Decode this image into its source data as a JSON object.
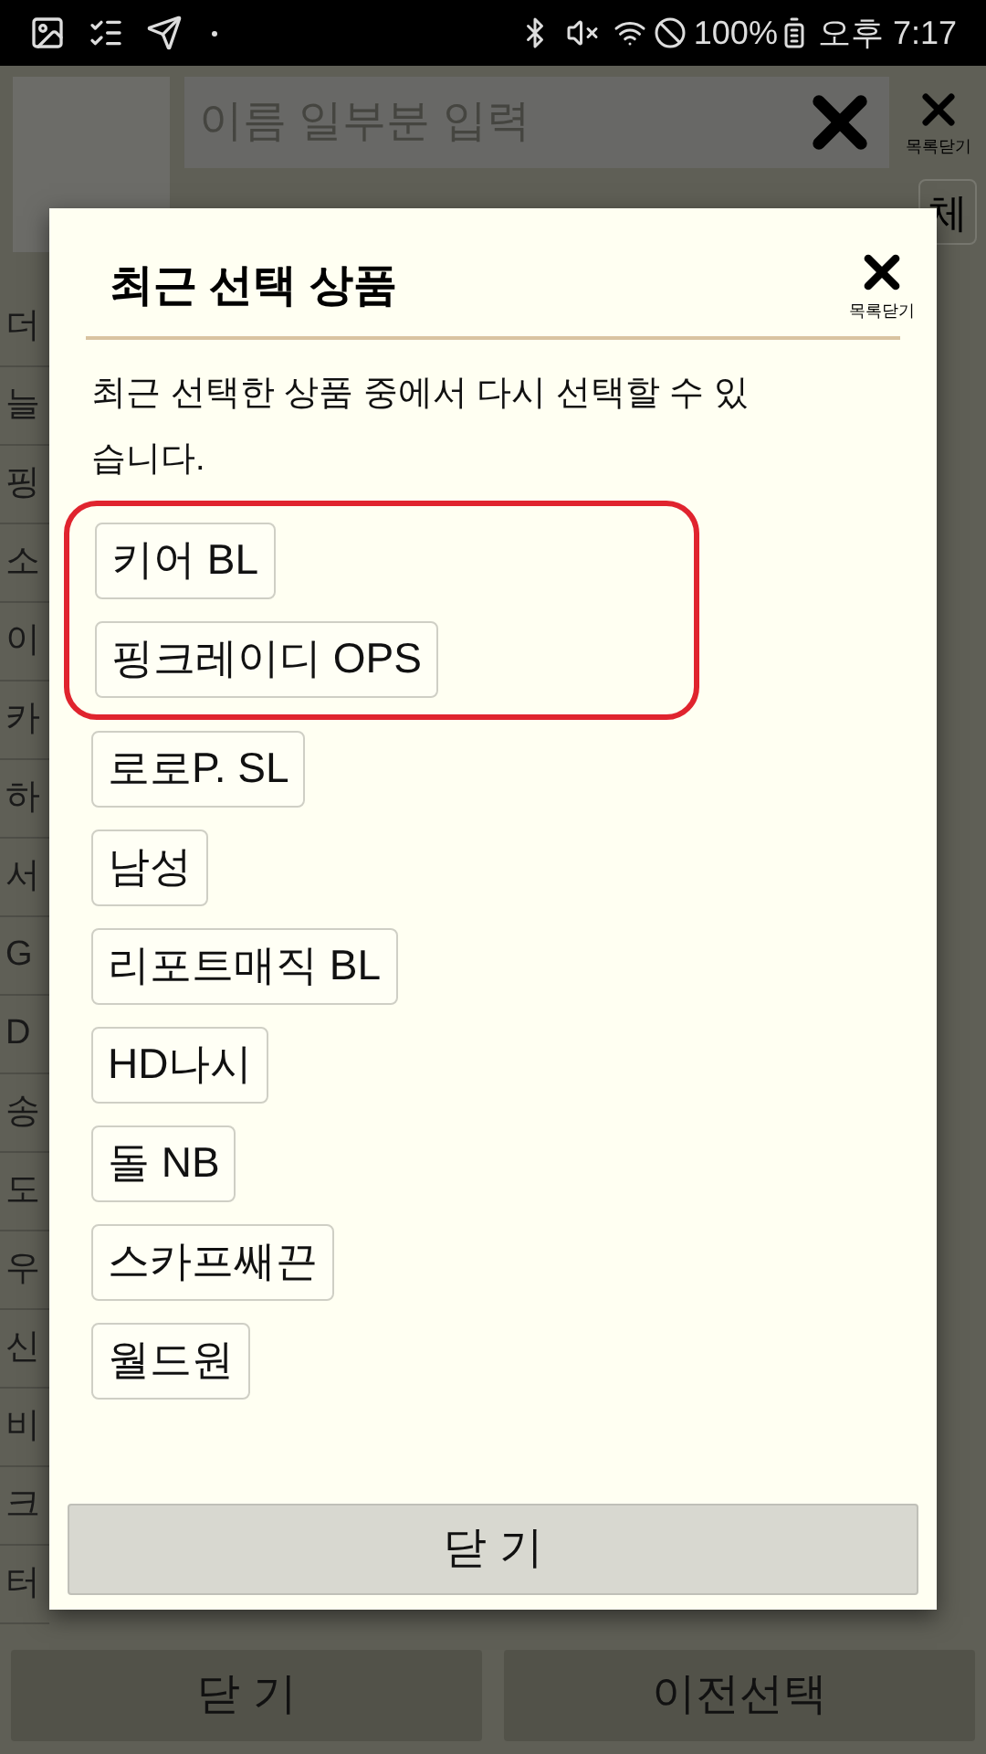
{
  "status_bar": {
    "battery": "100%",
    "time": "오후 7:17"
  },
  "background": {
    "search": {
      "placeholder": "이름 일부분 입력"
    },
    "close_label": "목록닫기",
    "all_button": "체",
    "list": [
      "더",
      "늘",
      "핑",
      "소",
      "이",
      "카",
      "하",
      "서",
      "G",
      "D",
      "송",
      "도",
      "우",
      "신",
      "비",
      "크",
      "터"
    ],
    "buttons": [
      "닫 기",
      "이전선택"
    ]
  },
  "dialog": {
    "title": "최근 선택 상품",
    "close_label": "목록닫기",
    "description": "최근 선택한 상품 중에서 다시 선택할 수 있습니다.",
    "items": [
      {
        "label": "키어 BL",
        "highlighted": true
      },
      {
        "label": "핑크레이디 OPS",
        "highlighted": true
      },
      {
        "label": "로로P. SL",
        "highlighted": false
      },
      {
        "label": "남성",
        "highlighted": false
      },
      {
        "label": "리포트매직 BL",
        "highlighted": false
      },
      {
        "label": "HD나시",
        "highlighted": false
      },
      {
        "label": "돌 NB",
        "highlighted": false
      },
      {
        "label": "스카프쌔끈",
        "highlighted": false
      },
      {
        "label": "월드원",
        "highlighted": false
      }
    ],
    "close_button": "닫 기"
  }
}
